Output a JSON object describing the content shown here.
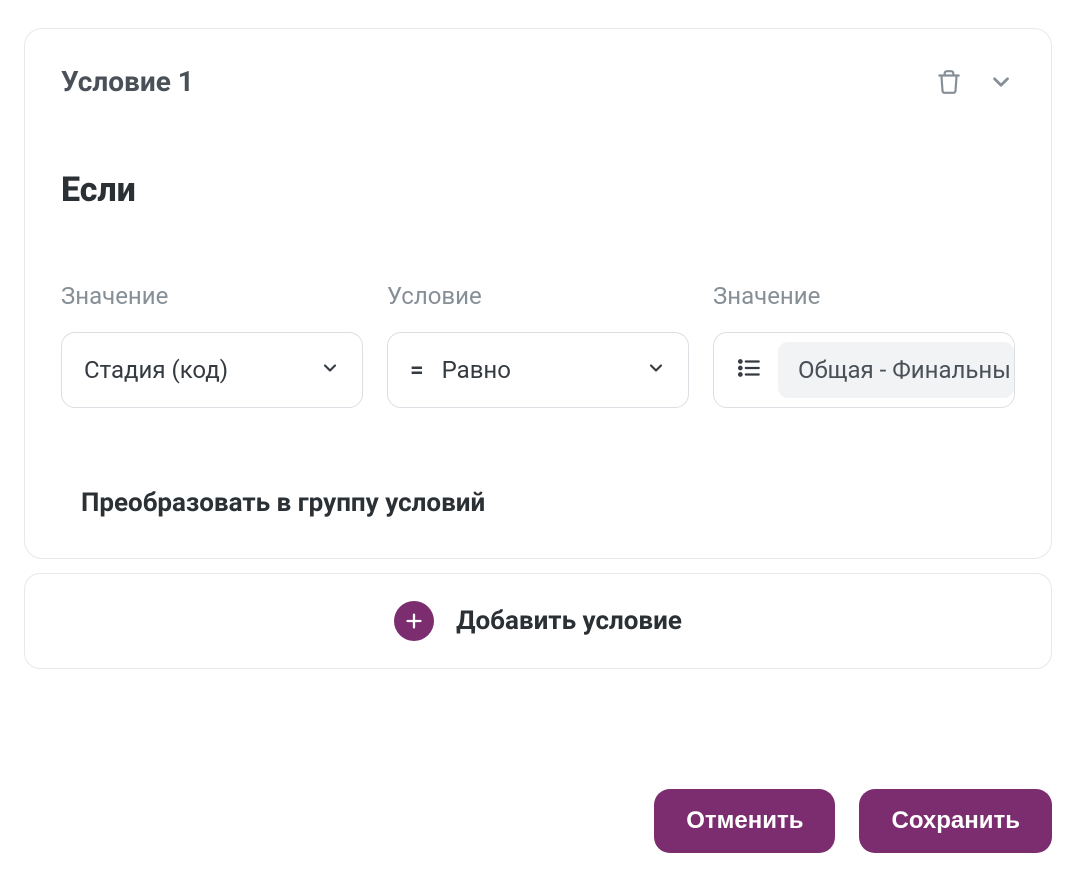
{
  "condition": {
    "title": "Условие 1",
    "if_label": "Если",
    "fields": {
      "value_left_label": "Значение",
      "value_left_selected": "Стадия (код)",
      "operator_label": "Условие",
      "operator_sign": "=",
      "operator_selected": "Равно",
      "value_right_label": "Значение",
      "value_right_chip": "Общая - Финальны"
    },
    "convert_label": "Преобразовать в группу условий"
  },
  "add_condition_label": "Добавить условие",
  "buttons": {
    "cancel": "Отменить",
    "save": "Сохранить"
  }
}
